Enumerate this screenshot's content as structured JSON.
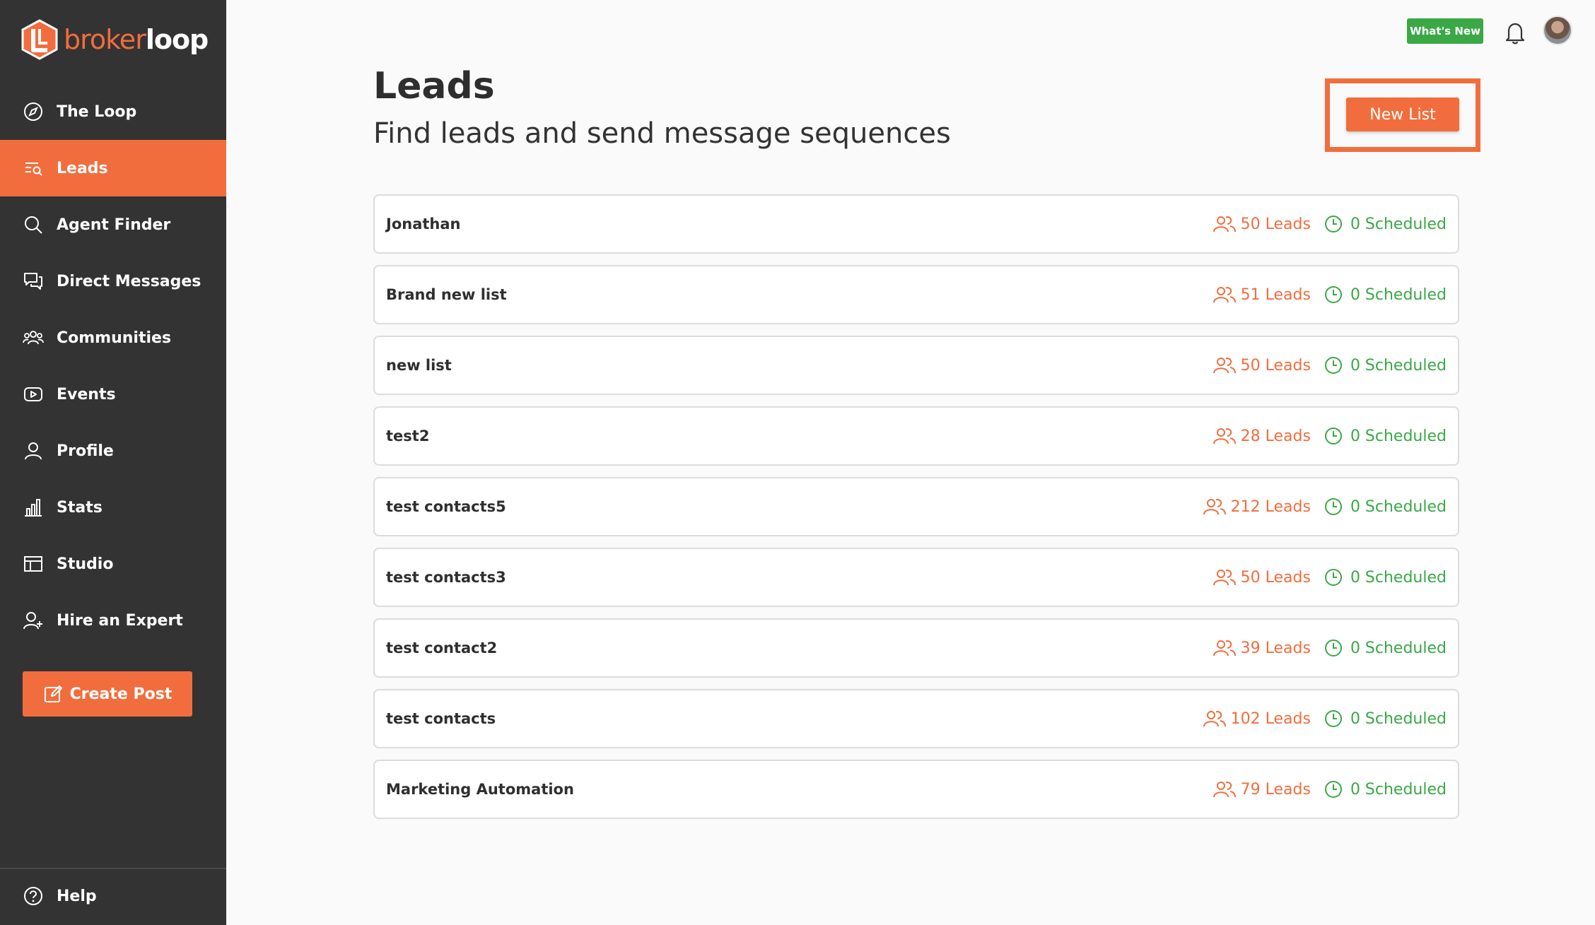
{
  "brand": {
    "name_part1": "broker",
    "name_part2": "loop",
    "accent": "#f26d3d"
  },
  "sidebar": {
    "items": [
      {
        "label": "The Loop",
        "icon": "compass-icon",
        "active": false
      },
      {
        "label": "Leads",
        "icon": "leads-list-icon",
        "active": true
      },
      {
        "label": "Agent Finder",
        "icon": "search-icon",
        "active": false
      },
      {
        "label": "Direct Messages",
        "icon": "chat-icon",
        "active": false
      },
      {
        "label": "Communities",
        "icon": "users-icon",
        "active": false
      },
      {
        "label": "Events",
        "icon": "video-icon",
        "active": false
      },
      {
        "label": "Profile",
        "icon": "user-icon",
        "active": false
      },
      {
        "label": "Stats",
        "icon": "bar-chart-icon",
        "active": false
      },
      {
        "label": "Studio",
        "icon": "layout-icon",
        "active": false
      },
      {
        "label": "Hire an Expert",
        "icon": "user-plus-icon",
        "active": false
      }
    ],
    "create_post_label": "Create Post",
    "help_label": "Help"
  },
  "topbar": {
    "whats_new_label": "What's New",
    "whats_new_color": "#3aa845"
  },
  "header": {
    "title": "Leads",
    "subtitle": "Find leads and send message sequences",
    "new_list_label": "New List"
  },
  "lists": [
    {
      "name": "Jonathan",
      "leads": "50 Leads",
      "scheduled": "0 Scheduled"
    },
    {
      "name": "Brand new list",
      "leads": "51 Leads",
      "scheduled": "0 Scheduled"
    },
    {
      "name": "new list",
      "leads": "50 Leads",
      "scheduled": "0 Scheduled"
    },
    {
      "name": "test2",
      "leads": "28 Leads",
      "scheduled": "0 Scheduled"
    },
    {
      "name": "test contacts5",
      "leads": "212 Leads",
      "scheduled": "0 Scheduled"
    },
    {
      "name": "test contacts3",
      "leads": "50 Leads",
      "scheduled": "0 Scheduled"
    },
    {
      "name": "test contact2",
      "leads": "39 Leads",
      "scheduled": "0 Scheduled"
    },
    {
      "name": "test contacts",
      "leads": "102 Leads",
      "scheduled": "0 Scheduled"
    },
    {
      "name": "Marketing Automation",
      "leads": "79 Leads",
      "scheduled": "0 Scheduled"
    }
  ]
}
